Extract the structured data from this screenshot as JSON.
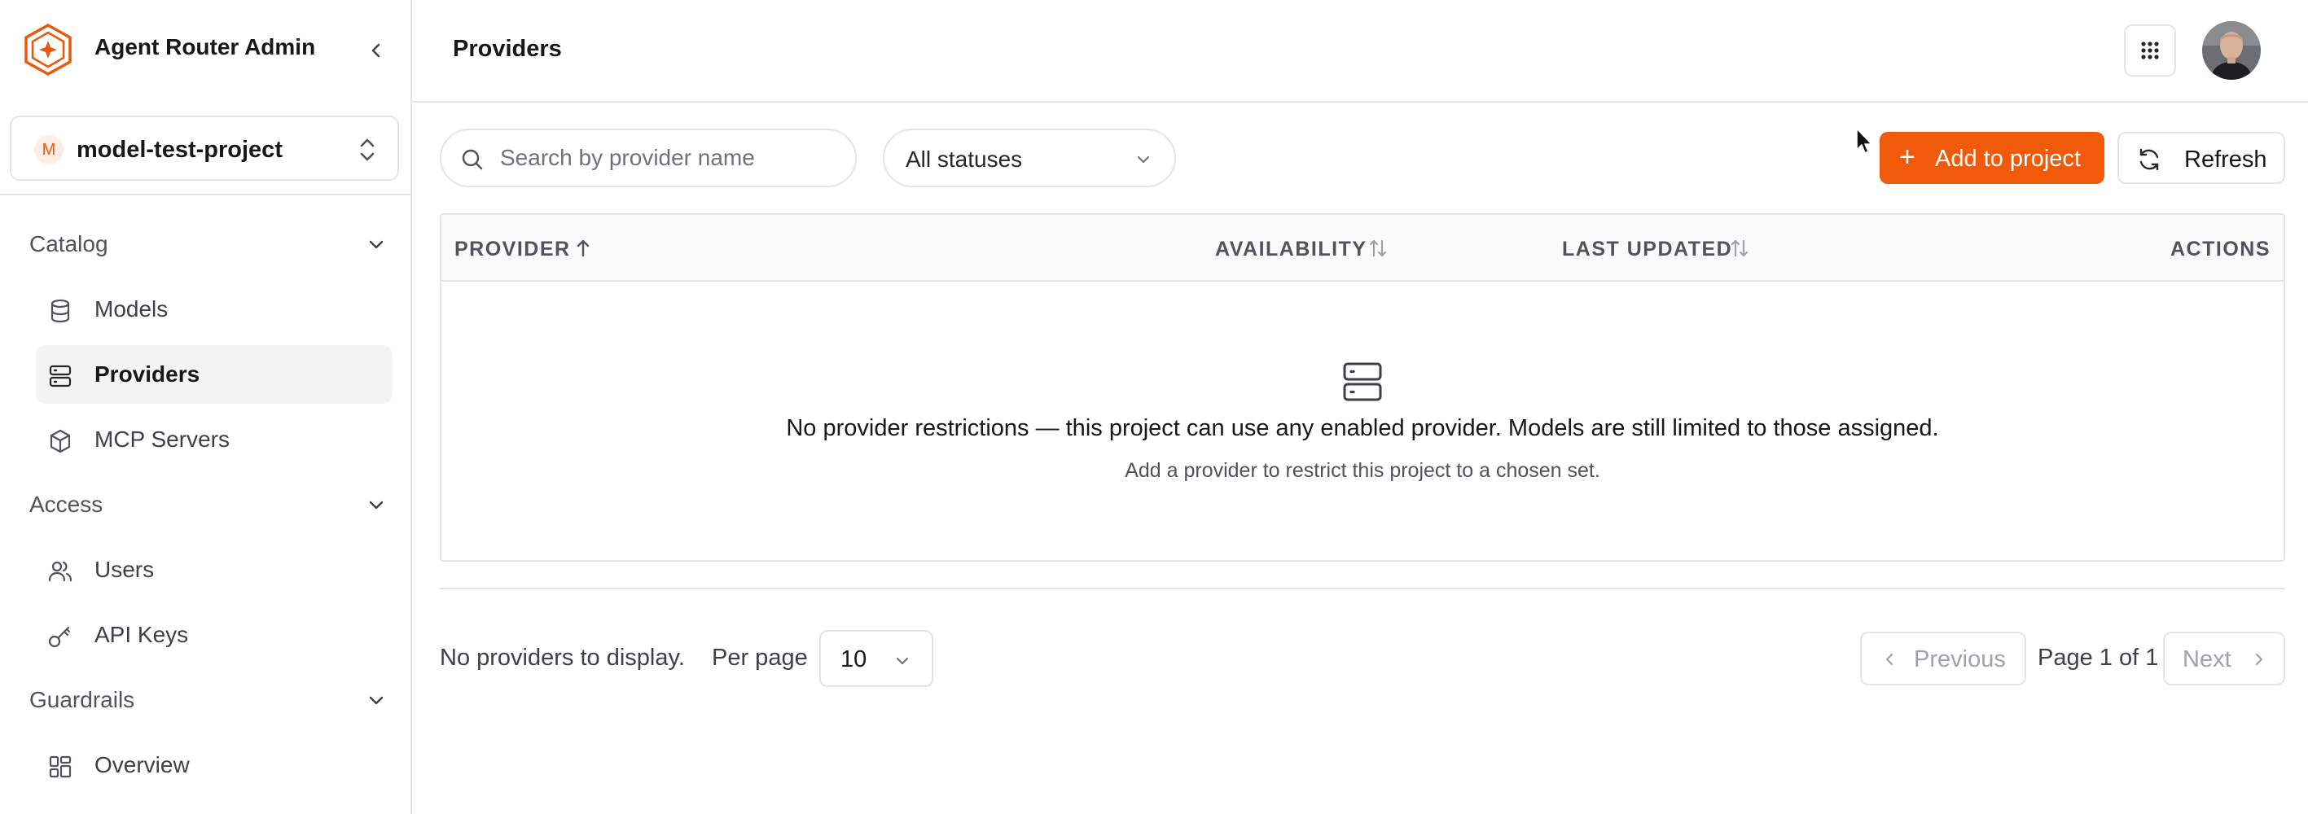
{
  "app": {
    "title": "Agent Router Admin"
  },
  "project": {
    "initial": "M",
    "name": "model-test-project"
  },
  "sidebar": {
    "sections": [
      {
        "label": "Catalog",
        "items": [
          {
            "label": "Models",
            "icon": "database-icon"
          },
          {
            "label": "Providers",
            "icon": "server-icon",
            "active": true
          },
          {
            "label": "MCP Servers",
            "icon": "box-icon"
          }
        ]
      },
      {
        "label": "Access",
        "items": [
          {
            "label": "Users",
            "icon": "users-icon"
          },
          {
            "label": "API Keys",
            "icon": "key-icon"
          }
        ]
      },
      {
        "label": "Guardrails",
        "items": [
          {
            "label": "Overview",
            "icon": "layout-grid-icon"
          }
        ]
      }
    ]
  },
  "header": {
    "page_title": "Providers"
  },
  "toolbar": {
    "search_placeholder": "Search by provider name",
    "status_filter": "All statuses",
    "add_label": "Add to project",
    "refresh_label": "Refresh"
  },
  "table": {
    "columns": [
      {
        "label": "PROVIDER",
        "sort": "asc"
      },
      {
        "label": "AVAILABILITY",
        "sort": "none"
      },
      {
        "label": "LAST UPDATED",
        "sort": "none"
      },
      {
        "label": "ACTIONS"
      }
    ],
    "empty_title": "No provider restrictions — this project can use any enabled provider. Models are still limited to those assigned.",
    "empty_subtitle": "Add a provider to restrict this project to a chosen set."
  },
  "pagination": {
    "summary": "No providers to display.",
    "per_page_label": "Per page",
    "per_page_value": "10",
    "previous_label": "Previous",
    "page_info": "Page 1 of 1",
    "next_label": "Next"
  },
  "colors": {
    "accent": "#f05a0a",
    "border": "#e4e4e7",
    "active_bg": "#f4f4f5"
  }
}
